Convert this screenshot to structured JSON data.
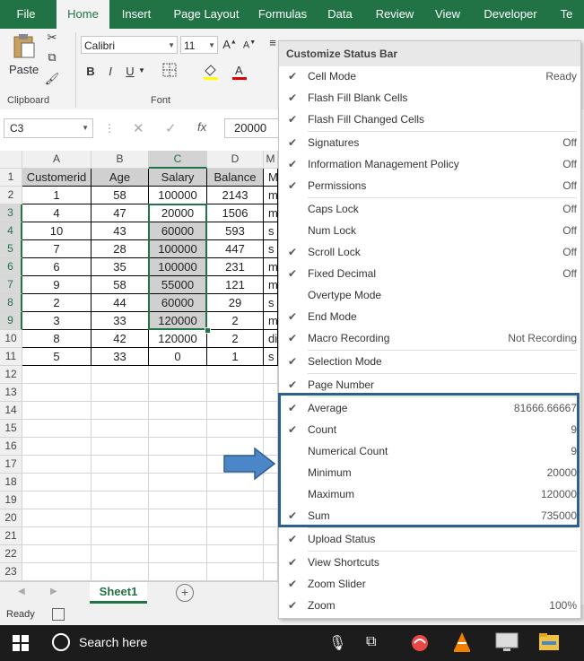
{
  "ribbon_tabs": [
    "File",
    "Home",
    "Insert",
    "Page Layout",
    "Formulas",
    "Data",
    "Review",
    "View",
    "Developer",
    "Te"
  ],
  "ribbon": {
    "paste_label": "Paste",
    "clipboard_label": "Clipboard",
    "font_label": "Font",
    "font_name": "Calibri",
    "font_size": "11",
    "bold": "B",
    "italic": "I",
    "underline": "U",
    "grow": "A",
    "shrink": "A"
  },
  "formula_bar": {
    "name_box": "C3",
    "fx": "fx",
    "value": "20000"
  },
  "columns": [
    "A",
    "B",
    "C",
    "D",
    "M"
  ],
  "rows": [
    "1",
    "2",
    "3",
    "4",
    "5",
    "6",
    "7",
    "8",
    "9",
    "10",
    "11",
    "12",
    "13",
    "14",
    "15",
    "16",
    "17",
    "18",
    "19",
    "20",
    "21",
    "22",
    "23"
  ],
  "table": {
    "headers": [
      "Customerid",
      "Age",
      "Salary",
      "Balance",
      "M"
    ],
    "data": [
      [
        "1",
        "58",
        "100000",
        "2143",
        "m"
      ],
      [
        "4",
        "47",
        "20000",
        "1506",
        "m"
      ],
      [
        "10",
        "43",
        "60000",
        "593",
        "s"
      ],
      [
        "7",
        "28",
        "100000",
        "447",
        "s"
      ],
      [
        "6",
        "35",
        "100000",
        "231",
        "m"
      ],
      [
        "9",
        "58",
        "55000",
        "121",
        "m"
      ],
      [
        "2",
        "44",
        "60000",
        "29",
        "s"
      ],
      [
        "3",
        "33",
        "120000",
        "2",
        "m"
      ],
      [
        "8",
        "42",
        "120000",
        "2",
        "di"
      ],
      [
        "5",
        "33",
        "0",
        "1",
        "s"
      ]
    ]
  },
  "sheet_tab": "Sheet1",
  "status_text": "Ready",
  "menu": {
    "title": "Customize Status Bar",
    "groups": [
      [
        {
          "label": "Cell Mode",
          "value": "Ready",
          "checked": true
        },
        {
          "label": "Flash Fill Blank Cells",
          "value": "",
          "checked": true
        },
        {
          "label": "Flash Fill Changed Cells",
          "value": "",
          "checked": true
        }
      ],
      [
        {
          "label": "Signatures",
          "value": "Off",
          "checked": true
        },
        {
          "label": "Information Management Policy",
          "value": "Off",
          "checked": true
        },
        {
          "label": "Permissions",
          "value": "Off",
          "checked": true
        }
      ],
      [
        {
          "label": "Caps Lock",
          "value": "Off",
          "checked": false
        },
        {
          "label": "Num Lock",
          "value": "Off",
          "checked": false
        },
        {
          "label": "Scroll Lock",
          "value": "Off",
          "checked": true
        },
        {
          "label": "Fixed Decimal",
          "value": "Off",
          "checked": true
        },
        {
          "label": "Overtype Mode",
          "value": "",
          "checked": false
        },
        {
          "label": "End Mode",
          "value": "",
          "checked": true
        },
        {
          "label": "Macro Recording",
          "value": "Not Recording",
          "checked": true
        }
      ],
      [
        {
          "label": "Selection Mode",
          "value": "",
          "checked": true
        }
      ],
      [
        {
          "label": "Page Number",
          "value": "",
          "checked": true
        }
      ],
      [
        {
          "label": "Average",
          "value": "81666.66667",
          "checked": true
        },
        {
          "label": "Count",
          "value": "9",
          "checked": true
        },
        {
          "label": "Numerical Count",
          "value": "9",
          "checked": false
        },
        {
          "label": "Minimum",
          "value": "20000",
          "checked": false
        },
        {
          "label": "Maximum",
          "value": "120000",
          "checked": false
        },
        {
          "label": "Sum",
          "value": "735000",
          "checked": true
        }
      ],
      [
        {
          "label": "Upload Status",
          "value": "",
          "checked": true
        }
      ],
      [
        {
          "label": "View Shortcuts",
          "value": "",
          "checked": true
        },
        {
          "label": "Zoom Slider",
          "value": "",
          "checked": true
        },
        {
          "label": "Zoom",
          "value": "100%",
          "checked": true
        }
      ]
    ]
  },
  "taskbar": {
    "search_placeholder": "Search here"
  },
  "colors": {
    "excel_green": "#217346",
    "highlight_box": "#2f5f8f",
    "arrow_blue": "#4a86c8"
  }
}
